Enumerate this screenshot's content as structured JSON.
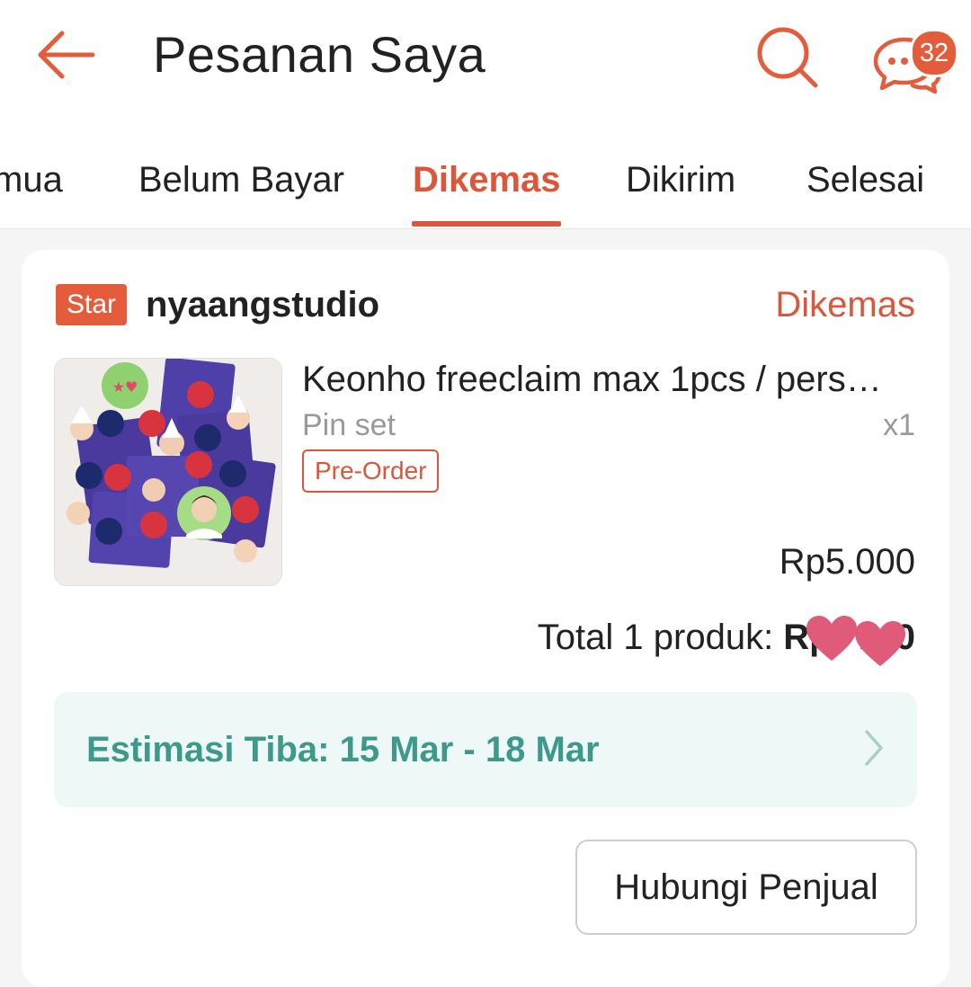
{
  "header": {
    "title": "Pesanan Saya",
    "chat_badge_count": "32",
    "accent_color": "#e35c3c"
  },
  "tabs": [
    {
      "label": "Semua",
      "visible_text": "mua",
      "active": false
    },
    {
      "label": "Belum Bayar",
      "active": false
    },
    {
      "label": "Dikemas",
      "active": true
    },
    {
      "label": "Dikirim",
      "active": false
    },
    {
      "label": "Selesai",
      "active": false
    }
  ],
  "order": {
    "shop_badge": "Star",
    "shop_name": "nyaangstudio",
    "status": "Dikemas",
    "product": {
      "name": "Keonho freeclaim max 1pcs / pers…",
      "variant": "Pin set",
      "quantity": "x1",
      "tag": "Pre-Order",
      "price": "Rp5.000",
      "thumbnail_icon": "pin-set-photo"
    },
    "total": {
      "label": "Total 1 produk: ",
      "amount": "Rp",
      "amount_tail": ".",
      "amount_end": "0",
      "obscured_by": "heart-stickers"
    },
    "eta": {
      "text": "Estimasi Tiba: 15 Mar - 18 Mar",
      "color": "#3d9a8b"
    },
    "contact_button": "Hubungi Penjual"
  }
}
